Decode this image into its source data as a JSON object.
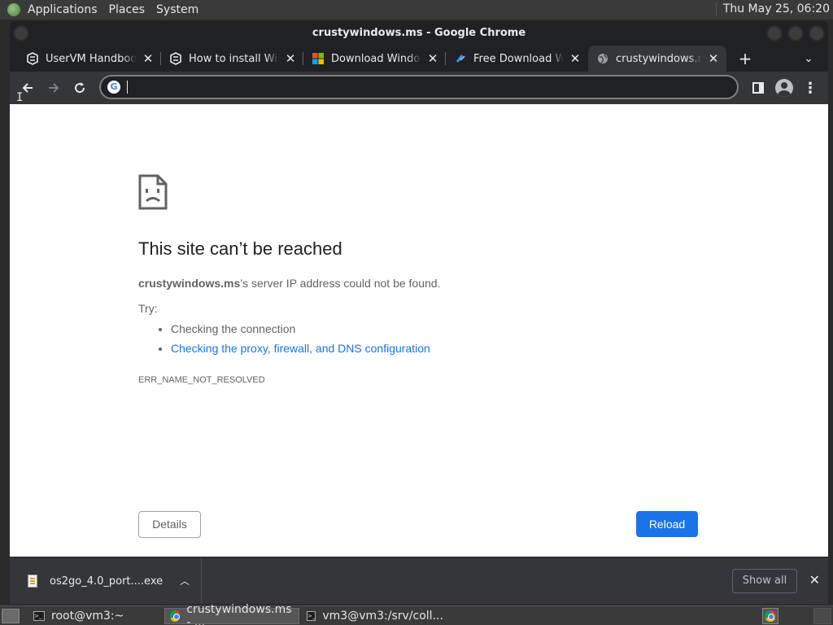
{
  "top_panel": {
    "menus": [
      "Applications",
      "Places",
      "System"
    ],
    "clock": "Thu May 25, 06:20"
  },
  "window": {
    "title": "crustywindows.ms - Google Chrome"
  },
  "tabs": [
    {
      "title": "UserVM Handbook",
      "icon": "openstack-icon",
      "active": false
    },
    {
      "title": "How to install Wind",
      "icon": "openstack-icon",
      "active": false
    },
    {
      "title": "Download Windows",
      "icon": "microsoft-logo-icon",
      "active": false
    },
    {
      "title": "Free Download Win",
      "icon": "download-site-icon",
      "active": false
    },
    {
      "title": "crustywindows.ms",
      "icon": "globe-icon",
      "active": true
    }
  ],
  "omnibox": {
    "value": "",
    "placeholder": ""
  },
  "error_page": {
    "title": "This site can’t be reached",
    "host": "crustywindows.ms",
    "description": "’s server IP address could not be found.",
    "try_label": "Try:",
    "suggestions": [
      {
        "text": "Checking the connection",
        "link": false
      },
      {
        "text": "Checking the proxy, firewall, and DNS configuration",
        "link": true
      }
    ],
    "error_code": "ERR_NAME_NOT_RESOLVED",
    "details_label": "Details",
    "reload_label": "Reload"
  },
  "download_shelf": {
    "file_name": "os2go_4.0_port....exe",
    "show_all_label": "Show all"
  },
  "taskbar": {
    "tasks": [
      {
        "label": "root@vm3:~",
        "icon": "terminal-icon",
        "active": false
      },
      {
        "label": "crustywindows.ms - ...",
        "icon": "chrome-icon",
        "active": true
      },
      {
        "label": "vm3@vm3:/srv/coll...",
        "icon": "terminal-icon",
        "active": false
      }
    ]
  },
  "colors": {
    "accent_blue": "#1a73e8",
    "chrome_dark": "#202124",
    "toolbar_dark": "#35363a"
  }
}
